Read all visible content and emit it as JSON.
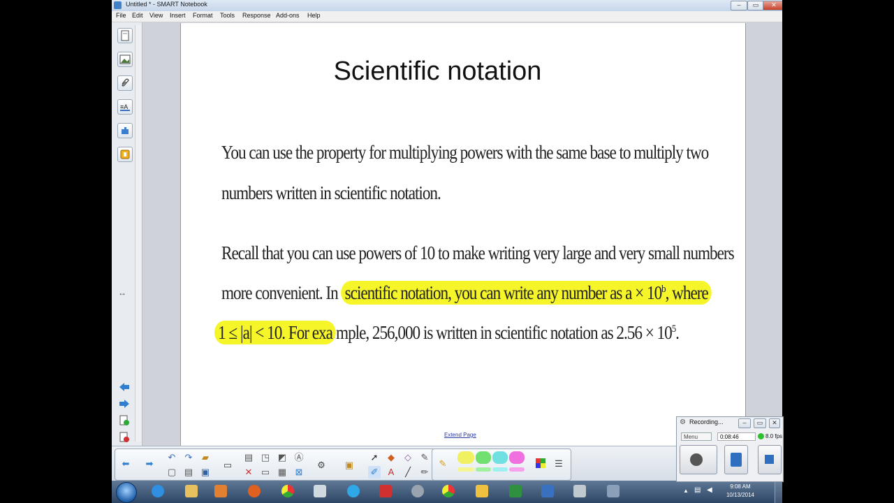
{
  "window": {
    "title": "Untitled * - SMART Notebook"
  },
  "menu": [
    "File",
    "Edit",
    "View",
    "Insert",
    "Format",
    "Tools",
    "Response",
    "Add-ons",
    "Help"
  ],
  "page": {
    "title": "Scientific notation",
    "para1_line1": "You can use the property for multiplying powers with the same base to multiply two",
    "para1_line2": "numbers written in scientific notation.",
    "para2_line1": "Recall that you can use powers of 10 to make writing very large and very small numbers",
    "para2_line2_pre": "more convenient. In ",
    "para2_line2_hl": "scientific notation, you can write any number as a × 10",
    "para2_line2_sup": "b",
    "para2_line2_post": ", where",
    "para2_line3_hl": "1 ≤ |a| < 10. For exa",
    "para2_line3_rest": "mple, 256,000 is written in scientific notation as 2.56 × 10",
    "para2_line3_sup": "5",
    "para2_line3_end": ".",
    "extend_link": "Extend Page"
  },
  "recorder": {
    "title": "Recording...",
    "menu_label": "Menu",
    "elapsed": "0:08:46",
    "fps": "8.0 fps"
  },
  "clock": {
    "time": "9:08 AM",
    "date": "10/13/2014"
  },
  "colors": {
    "highlight": "#f5f52a",
    "taskbar": "#2e4665",
    "link": "#2a3aa0"
  }
}
